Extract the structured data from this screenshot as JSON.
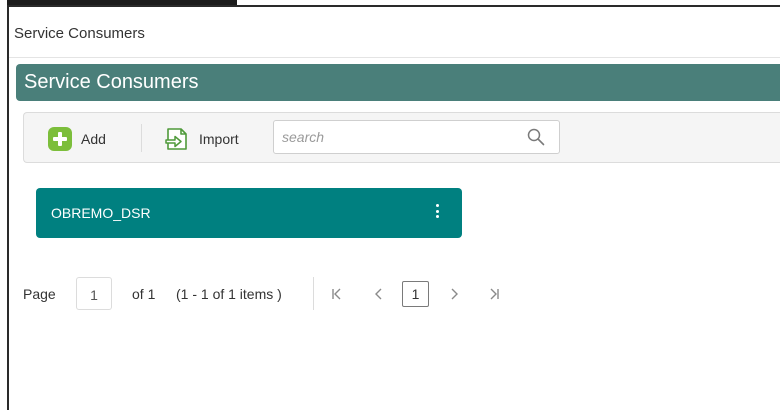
{
  "window": {
    "title": "Service Consumers"
  },
  "banner": {
    "title": "Service Consumers",
    "color": "#4a7f7a"
  },
  "toolbar": {
    "add_label": "Add",
    "import_label": "Import",
    "search_placeholder": "search",
    "icons": [
      "add-icon",
      "import-icon",
      "search-icon"
    ]
  },
  "consumers": [
    {
      "name": "OBREMO_DSR",
      "color": "#008080"
    }
  ],
  "pager": {
    "page_label": "Page",
    "page_value": "1",
    "of_label": "of 1",
    "range_label": "(1 - 1 of 1 items )",
    "first_glyph": "K",
    "prev_glyph": "<",
    "current_page": "1",
    "next_glyph": ">",
    "last_glyph": ">|"
  }
}
